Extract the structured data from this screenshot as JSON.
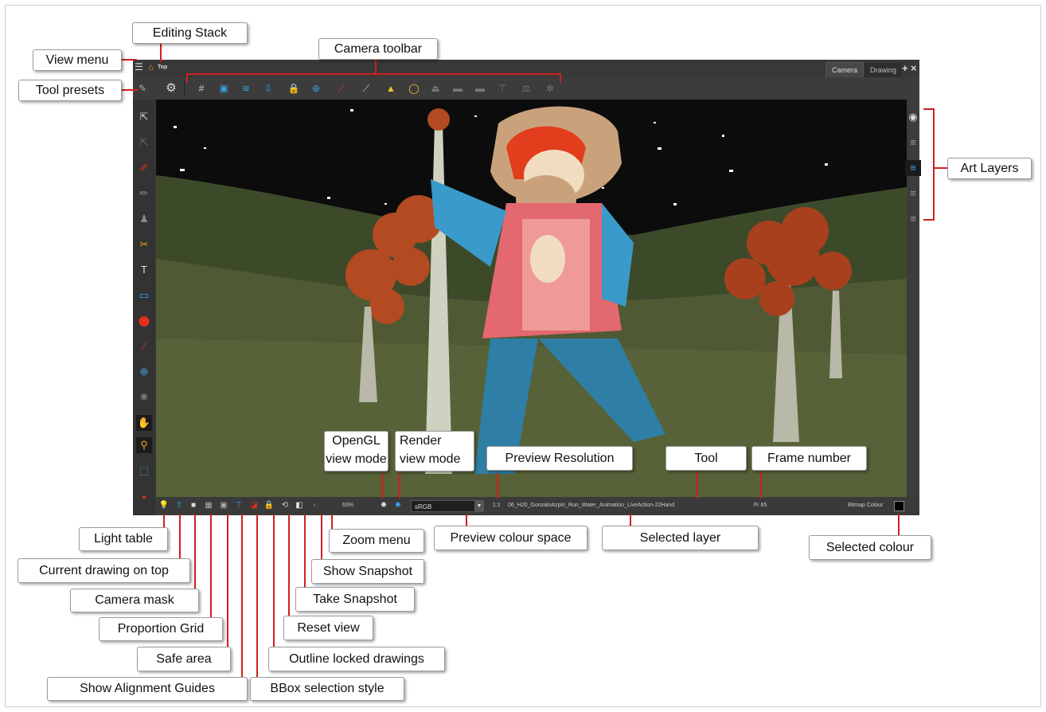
{
  "window": {
    "breadcrumb": "Top",
    "tabs": [
      {
        "label": "Camera"
      },
      {
        "label": "Drawing"
      }
    ],
    "add_view": "+",
    "close_view": "×"
  },
  "status_bar": {
    "zoom": "63%",
    "colour_space": "sRGB",
    "preview_resolution": "1:1",
    "selected_layer": "06_H20_GonzaloAzpiri_Run_Water_Animation_LiveAction-22Hand",
    "frame": "Fr 65",
    "tool": "Bitmap Colour",
    "selected_colour": "#000000"
  },
  "callouts": {
    "editing_stack": "Editing Stack",
    "view_menu": "View menu",
    "camera_toolbar": "Camera toolbar",
    "tool_presets": "Tool presets",
    "art_layers": "Art Layers",
    "opengl_line1": "OpenGL",
    "opengl_line2": "view mode",
    "render_line1": "Render",
    "render_line2": "view mode",
    "preview_resolution": "Preview Resolution",
    "tool": "Tool",
    "frame_number": "Frame number",
    "light_table": "Light table",
    "current_drawing_on_top": "Current drawing on top",
    "camera_mask": "Camera mask",
    "proportion_grid": "Proportion Grid",
    "safe_area": "Safe area",
    "show_alignment_guides": "Show Alignment Guides",
    "zoom_menu": "Zoom menu",
    "preview_colour_space": "Preview colour space",
    "selected_layer": "Selected layer",
    "selected_colour": "Selected colour",
    "show_snapshot": "Show Snapshot",
    "take_snapshot": "Take Snapshot",
    "reset_view": "Reset view",
    "outline_locked_drawings": "Outline locked drawings",
    "bbox_selection_style": "BBox selection style"
  },
  "colors": {
    "leader": "#d11f1f",
    "ui_dark": "#3a3a3a",
    "accent_orange": "#f0a020"
  }
}
